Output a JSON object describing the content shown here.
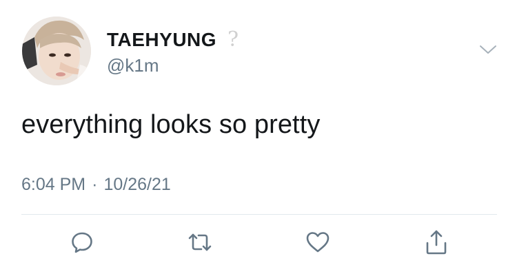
{
  "tweet": {
    "display_name": "TAEHYUNG",
    "handle": "@k1m",
    "name_extra_icon": "question-mark-icon",
    "name_extra_glyph": "?",
    "text": "everything looks so pretty",
    "time": "6:04 PM",
    "separator": "·",
    "date": "10/26/21"
  },
  "icons": {
    "avatar": "profile-photo",
    "menu": "chevron-down-icon",
    "reply": "reply-bubble-icon",
    "retweet": "retweet-icon",
    "like": "heart-icon",
    "share": "share-icon"
  },
  "colors": {
    "text": "#14171a",
    "secondary": "#657786",
    "icon": "#657786",
    "divider": "#e1e8ed"
  }
}
